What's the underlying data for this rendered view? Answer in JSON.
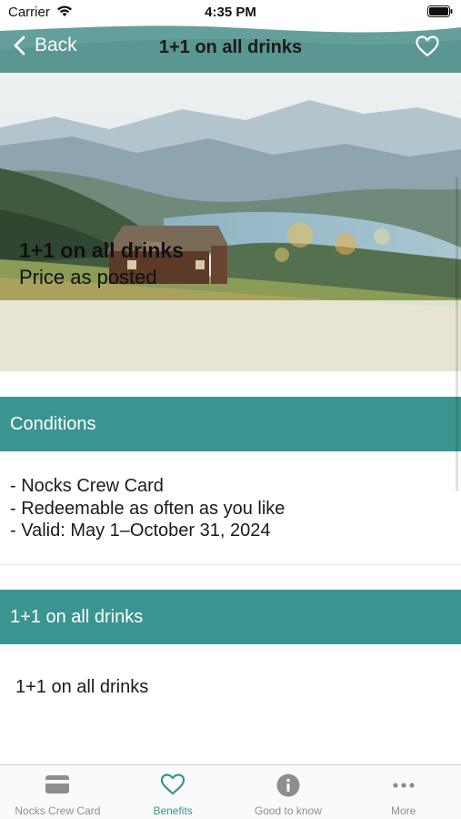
{
  "status_bar": {
    "carrier": "Carrier",
    "time": "4:35 PM"
  },
  "nav": {
    "back_label": "Back",
    "title": "1+1 on all drinks",
    "favorite_icon": "heart-outline-icon"
  },
  "hero": {
    "title": "1+1 on all drinks",
    "subtitle": "Price as posted"
  },
  "conditions": {
    "header": "Conditions",
    "items": [
      "- Nocks Crew Card",
      "- Redeemable as often as you like",
      "- Valid: May 1–October 31, 2024"
    ]
  },
  "details": {
    "header": "1+1 on all drinks",
    "body": "1+1 on all drinks"
  },
  "tabs": [
    {
      "label": "Nocks Crew Card",
      "icon": "card-icon",
      "active": false
    },
    {
      "label": "Benefits",
      "icon": "heart-icon",
      "active": true
    },
    {
      "label": "Good to know",
      "icon": "info-icon",
      "active": false
    },
    {
      "label": "More",
      "icon": "more-icon",
      "active": false
    }
  ],
  "colors": {
    "teal": "#3a9590",
    "header_teal": "#5f9c98",
    "tab_inactive": "#8e8e8e"
  }
}
